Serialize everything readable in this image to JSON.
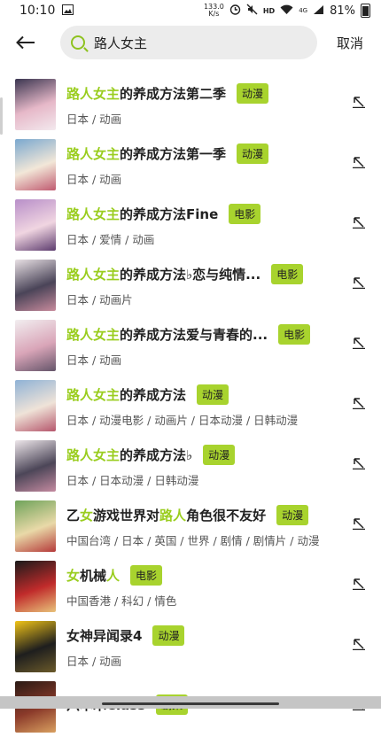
{
  "status": {
    "time": "10:10",
    "net_speed_value": "133.0",
    "net_speed_unit": "K/s",
    "hd_label": "HD",
    "signal_label": "4G",
    "battery_pct": "81%"
  },
  "search": {
    "query": "路人女主",
    "cancel_label": "取消"
  },
  "results": [
    {
      "hl": "路人女主",
      "rest": "的养成方法第二季",
      "tag": "动漫",
      "meta": "日本 / 动画",
      "colors": [
        "#3a3550",
        "#e6b8c8",
        "#f3e9ee"
      ]
    },
    {
      "hl": "路人女主",
      "rest": "的养成方法第一季",
      "tag": "动漫",
      "meta": "日本 / 动画",
      "colors": [
        "#7aa8cf",
        "#f2e7d8",
        "#c05a70"
      ]
    },
    {
      "hl": "路人女主",
      "rest": "的养成方法Fine",
      "tag": "电影",
      "meta": "日本 / 爱情 / 动画",
      "colors": [
        "#b88fc9",
        "#f0d5e1",
        "#5c3b6e"
      ]
    },
    {
      "hl": "路人女主",
      "rest": "的养成方法♭恋与纯情...",
      "tag": "电影",
      "meta": "日本 / 动画片",
      "colors": [
        "#e8e0e4",
        "#4a4458",
        "#c78a9c"
      ]
    },
    {
      "hl": "路人女主",
      "rest": "的养成方法爱与青春的...",
      "tag": "电影",
      "meta": "日本 / 动画",
      "colors": [
        "#f2eef0",
        "#d9a5b8",
        "#65556a"
      ]
    },
    {
      "hl": "路人女主",
      "rest": "的养成方法",
      "tag": "动漫",
      "meta": "日本 / 动漫电影 / 动画片 / 日本动漫 / 日韩动漫",
      "colors": [
        "#8fb2d6",
        "#efe3d8",
        "#b5566c"
      ]
    },
    {
      "hl": "路人女主",
      "rest": "的养成方法♭",
      "tag": "动漫",
      "meta": "日本 / 日本动漫 / 日韩动漫",
      "colors": [
        "#ede6ea",
        "#4c4658",
        "#c48aa0"
      ]
    },
    {
      "pre": "乙",
      "hl1": "女",
      "mid": "游戏世界对",
      "hl2": "路人",
      "post": "角色很不友好",
      "tag": "动漫",
      "meta": "中国台湾 / 日本 / 英国 / 世界 / 剧情 / 剧情片 / 动漫",
      "colors": [
        "#6fa35a",
        "#e9d9a8",
        "#b53a3a"
      ]
    },
    {
      "hl": "女",
      "rest": "机械",
      "hl3": "人",
      "tag": "电影",
      "meta": "中国香港 / 科幻 / 情色",
      "colors": [
        "#1a1a1a",
        "#c02b2b",
        "#e8c27a"
      ]
    },
    {
      "plain": "女神异闻录4",
      "tag": "动漫",
      "meta": "日本 / 动画",
      "colors": [
        "#f0c418",
        "#1e1e1e",
        "#6b5a2a"
      ]
    },
    {
      "plain": "六本木Class",
      "tag": "剧集",
      "meta": "",
      "colors": [
        "#2a1a14",
        "#8b3a2a",
        "#d9a060"
      ]
    }
  ]
}
